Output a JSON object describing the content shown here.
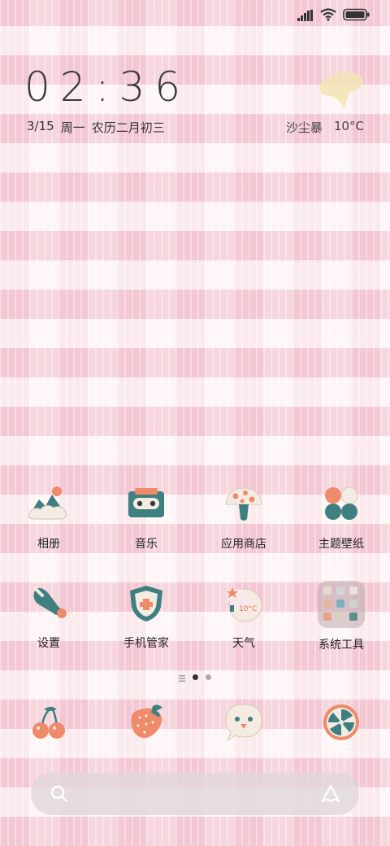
{
  "status_bar": {
    "signal_icon": "cellular-signal-icon",
    "wifi_icon": "wifi-icon",
    "battery_icon": "battery-icon"
  },
  "clock": {
    "time": "02:36"
  },
  "date": {
    "date": "3/15",
    "weekday": "周一",
    "lunar": "农历二月初三"
  },
  "weather": {
    "icon": "cloud-icon",
    "condition": "沙尘暴",
    "temperature": "10°C"
  },
  "apps": {
    "row1": [
      {
        "label": "相册",
        "icon": "photo-mountain-icon"
      },
      {
        "label": "音乐",
        "icon": "cassette-icon"
      },
      {
        "label": "应用商店",
        "icon": "mushroom-icon"
      },
      {
        "label": "主题壁纸",
        "icon": "four-circles-icon"
      }
    ],
    "row2": [
      {
        "label": "设置",
        "icon": "wrench-icon"
      },
      {
        "label": "手机管家",
        "icon": "shield-icon"
      },
      {
        "label": "天气",
        "icon": "moon-weather-icon",
        "badge": "10°C"
      },
      {
        "label": "系统工具",
        "icon": "folder-icon"
      }
    ]
  },
  "page_indicator": {
    "pages": 2,
    "current": 1
  },
  "dock": [
    {
      "icon": "cherry-icon"
    },
    {
      "icon": "strawberry-icon"
    },
    {
      "icon": "chat-bubble-icon"
    },
    {
      "icon": "orange-slice-icon"
    }
  ],
  "search": {
    "left_icon": "search-icon",
    "right_icon": "assistant-icon"
  },
  "colors": {
    "teal": "#3f7f80",
    "coral": "#ef8a6a",
    "cream": "#f4ece2",
    "pink_bg": "#f4c8d2"
  }
}
